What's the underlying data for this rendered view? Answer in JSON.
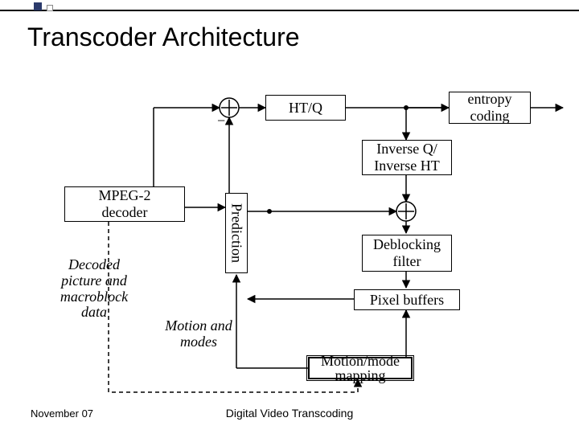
{
  "title": "Transcoder Architecture",
  "footer": {
    "date": "November 07",
    "subtitle": "Digital Video Transcoding"
  },
  "blocks": {
    "htq": "HT/Q",
    "entropy": "entropy\ncoding",
    "invqht": "Inverse Q/\nInverse HT",
    "mpeg2": "MPEG-2\ndecoder",
    "prediction": "Prediction",
    "deblock": "Deblocking\nfilter",
    "pixbuf": "Pixel buffers",
    "motionmap": "Motion/mode\nmapping"
  },
  "labels": {
    "decoded": "Decoded\npicture and\nmacroblock\ndata",
    "motionmodes": "Motion and\nmodes"
  }
}
